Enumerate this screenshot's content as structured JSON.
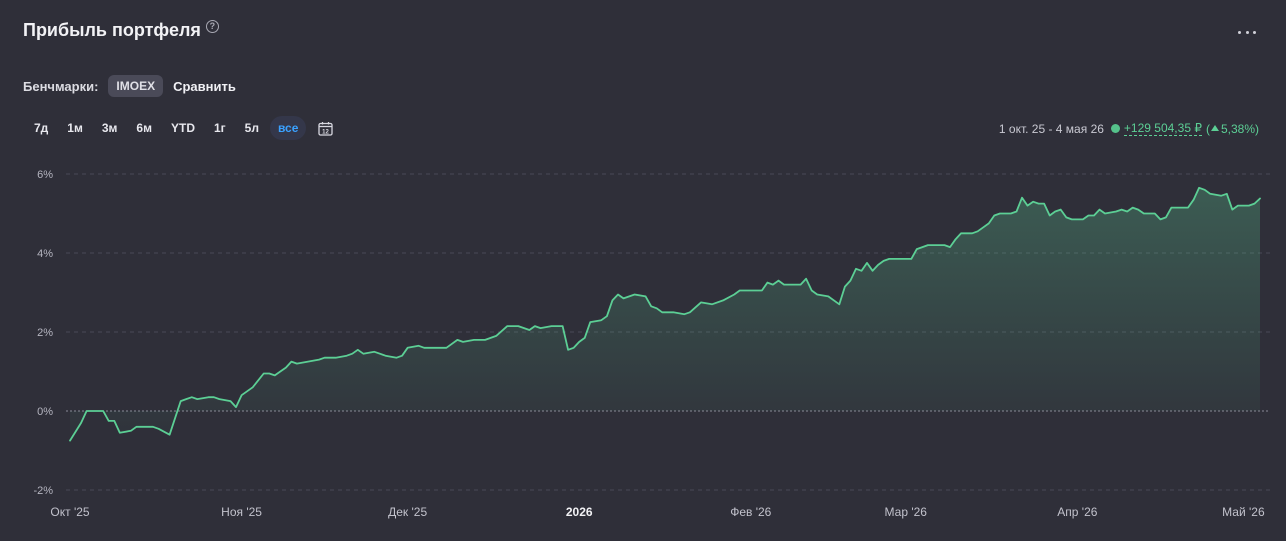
{
  "header": {
    "title": "Прибыль портфеля",
    "help_icon": "?"
  },
  "benchmarks": {
    "label": "Бенчмарки:",
    "chip": "IMOEX",
    "compare": "Сравнить"
  },
  "periods": [
    {
      "label": "7д",
      "active": false
    },
    {
      "label": "1м",
      "active": false
    },
    {
      "label": "3м",
      "active": false
    },
    {
      "label": "6м",
      "active": false
    },
    {
      "label": "YTD",
      "active": false
    },
    {
      "label": "1г",
      "active": false
    },
    {
      "label": "5л",
      "active": false
    },
    {
      "label": "все",
      "active": true
    }
  ],
  "calendar": {
    "day": "12",
    "icon": "calendar-icon"
  },
  "summary": {
    "range": "1 окт. 25 - 4 мая 26",
    "gain": "+129 504,35 ₽",
    "open": "(",
    "pct": "5,38%)"
  },
  "colors": {
    "bg": "#2f2f39",
    "line": "#5ccf95",
    "grid": "#4a4a58",
    "zero": "#8a8a96",
    "active": "#3aa1ff"
  },
  "chart_data": {
    "type": "area",
    "ylim": [
      -2,
      6.5
    ],
    "yticks": [
      -2,
      0,
      2,
      4,
      6
    ],
    "ytick_labels": [
      "-2%",
      "0%",
      "2%",
      "4%",
      "6%"
    ],
    "x_start": "2025-10-01",
    "x_end": "2026-05-04",
    "xticks": [
      {
        "date": "2025-10-01",
        "label": "Окт '25",
        "bold": false
      },
      {
        "date": "2025-11-01",
        "label": "Ноя '25",
        "bold": false
      },
      {
        "date": "2025-12-01",
        "label": "Дек '25",
        "bold": false
      },
      {
        "date": "2026-01-01",
        "label": "2026",
        "bold": true
      },
      {
        "date": "2026-02-01",
        "label": "Фев '26",
        "bold": false
      },
      {
        "date": "2026-03-01",
        "label": "Мар '26",
        "bold": false
      },
      {
        "date": "2026-04-01",
        "label": "Апр '26",
        "bold": false
      },
      {
        "date": "2026-05-01",
        "label": "Май '26",
        "bold": false
      }
    ],
    "series": [
      {
        "values": [
          [
            "2025-10-01",
            -0.75
          ],
          [
            "2025-10-03",
            -0.3
          ],
          [
            "2025-10-04",
            0.0
          ],
          [
            "2025-10-07",
            0.0
          ],
          [
            "2025-10-08",
            -0.25
          ],
          [
            "2025-10-09",
            -0.25
          ],
          [
            "2025-10-10",
            -0.55
          ],
          [
            "2025-10-12",
            -0.5
          ],
          [
            "2025-10-13",
            -0.4
          ],
          [
            "2025-10-16",
            -0.4
          ],
          [
            "2025-10-17",
            -0.45
          ],
          [
            "2025-10-19",
            -0.6
          ],
          [
            "2025-10-21",
            0.25
          ],
          [
            "2025-10-22",
            0.3
          ],
          [
            "2025-10-23",
            0.35
          ],
          [
            "2025-10-24",
            0.3
          ],
          [
            "2025-10-26",
            0.35
          ],
          [
            "2025-10-27",
            0.35
          ],
          [
            "2025-10-28",
            0.3
          ],
          [
            "2025-10-30",
            0.25
          ],
          [
            "2025-10-31",
            0.1
          ],
          [
            "2025-11-01",
            0.4
          ],
          [
            "2025-11-03",
            0.6
          ],
          [
            "2025-11-05",
            0.95
          ],
          [
            "2025-11-06",
            0.95
          ],
          [
            "2025-11-07",
            0.9
          ],
          [
            "2025-11-08",
            1.0
          ],
          [
            "2025-11-09",
            1.1
          ],
          [
            "2025-11-10",
            1.25
          ],
          [
            "2025-11-11",
            1.2
          ],
          [
            "2025-11-13",
            1.25
          ],
          [
            "2025-11-15",
            1.3
          ],
          [
            "2025-11-16",
            1.35
          ],
          [
            "2025-11-18",
            1.35
          ],
          [
            "2025-11-20",
            1.4
          ],
          [
            "2025-11-21",
            1.45
          ],
          [
            "2025-11-22",
            1.55
          ],
          [
            "2025-11-23",
            1.45
          ],
          [
            "2025-11-25",
            1.5
          ],
          [
            "2025-11-27",
            1.4
          ],
          [
            "2025-11-29",
            1.35
          ],
          [
            "2025-11-30",
            1.4
          ],
          [
            "2025-12-01",
            1.6
          ],
          [
            "2025-12-03",
            1.65
          ],
          [
            "2025-12-04",
            1.6
          ],
          [
            "2025-12-06",
            1.6
          ],
          [
            "2025-12-08",
            1.6
          ],
          [
            "2025-12-10",
            1.8
          ],
          [
            "2025-12-11",
            1.75
          ],
          [
            "2025-12-13",
            1.8
          ],
          [
            "2025-12-15",
            1.8
          ],
          [
            "2025-12-17",
            1.9
          ],
          [
            "2025-12-19",
            2.15
          ],
          [
            "2025-12-21",
            2.15
          ],
          [
            "2025-12-23",
            2.05
          ],
          [
            "2025-12-24",
            2.15
          ],
          [
            "2025-12-25",
            2.1
          ],
          [
            "2025-12-27",
            2.15
          ],
          [
            "2025-12-29",
            2.15
          ],
          [
            "2025-12-30",
            1.55
          ],
          [
            "2025-12-31",
            1.6
          ],
          [
            "2026-01-01",
            1.75
          ],
          [
            "2026-01-02",
            1.85
          ],
          [
            "2026-01-03",
            2.25
          ],
          [
            "2026-01-05",
            2.3
          ],
          [
            "2026-01-06",
            2.4
          ],
          [
            "2026-01-07",
            2.8
          ],
          [
            "2026-01-08",
            2.95
          ],
          [
            "2026-01-09",
            2.85
          ],
          [
            "2026-01-11",
            2.95
          ],
          [
            "2026-01-13",
            2.9
          ],
          [
            "2026-01-14",
            2.65
          ],
          [
            "2026-01-15",
            2.6
          ],
          [
            "2026-01-16",
            2.5
          ],
          [
            "2026-01-18",
            2.5
          ],
          [
            "2026-01-20",
            2.45
          ],
          [
            "2026-01-21",
            2.5
          ],
          [
            "2026-01-23",
            2.75
          ],
          [
            "2026-01-25",
            2.7
          ],
          [
            "2026-01-27",
            2.8
          ],
          [
            "2026-01-29",
            2.95
          ],
          [
            "2026-01-30",
            3.05
          ],
          [
            "2026-02-01",
            3.05
          ],
          [
            "2026-02-03",
            3.05
          ],
          [
            "2026-02-04",
            3.25
          ],
          [
            "2026-02-05",
            3.2
          ],
          [
            "2026-02-06",
            3.3
          ],
          [
            "2026-02-07",
            3.2
          ],
          [
            "2026-02-09",
            3.2
          ],
          [
            "2026-02-10",
            3.2
          ],
          [
            "2026-02-11",
            3.35
          ],
          [
            "2026-02-12",
            3.05
          ],
          [
            "2026-02-13",
            2.95
          ],
          [
            "2026-02-15",
            2.9
          ],
          [
            "2026-02-17",
            2.7
          ],
          [
            "2026-02-18",
            3.15
          ],
          [
            "2026-02-19",
            3.3
          ],
          [
            "2026-02-20",
            3.6
          ],
          [
            "2026-02-21",
            3.55
          ],
          [
            "2026-02-22",
            3.75
          ],
          [
            "2026-02-23",
            3.55
          ],
          [
            "2026-02-24",
            3.7
          ],
          [
            "2026-02-25",
            3.8
          ],
          [
            "2026-02-26",
            3.85
          ],
          [
            "2026-03-01",
            3.85
          ],
          [
            "2026-03-02",
            3.85
          ],
          [
            "2026-03-03",
            4.1
          ],
          [
            "2026-03-04",
            4.15
          ],
          [
            "2026-03-05",
            4.2
          ],
          [
            "2026-03-08",
            4.2
          ],
          [
            "2026-03-09",
            4.15
          ],
          [
            "2026-03-10",
            4.35
          ],
          [
            "2026-03-11",
            4.5
          ],
          [
            "2026-03-13",
            4.5
          ],
          [
            "2026-03-14",
            4.55
          ],
          [
            "2026-03-15",
            4.65
          ],
          [
            "2026-03-16",
            4.75
          ],
          [
            "2026-03-17",
            4.95
          ],
          [
            "2026-03-18",
            5.0
          ],
          [
            "2026-03-20",
            5.0
          ],
          [
            "2026-03-21",
            5.05
          ],
          [
            "2026-03-22",
            5.4
          ],
          [
            "2026-03-23",
            5.2
          ],
          [
            "2026-03-24",
            5.3
          ],
          [
            "2026-03-25",
            5.25
          ],
          [
            "2026-03-26",
            5.25
          ],
          [
            "2026-03-27",
            4.95
          ],
          [
            "2026-03-28",
            5.05
          ],
          [
            "2026-03-29",
            5.1
          ],
          [
            "2026-03-30",
            4.9
          ],
          [
            "2026-03-31",
            4.85
          ],
          [
            "2026-04-02",
            4.85
          ],
          [
            "2026-04-03",
            4.95
          ],
          [
            "2026-04-04",
            4.95
          ],
          [
            "2026-04-05",
            5.1
          ],
          [
            "2026-04-06",
            5.0
          ],
          [
            "2026-04-08",
            5.05
          ],
          [
            "2026-04-09",
            5.1
          ],
          [
            "2026-04-10",
            5.05
          ],
          [
            "2026-04-11",
            5.15
          ],
          [
            "2026-04-12",
            5.1
          ],
          [
            "2026-04-13",
            5.0
          ],
          [
            "2026-04-15",
            5.0
          ],
          [
            "2026-04-16",
            4.85
          ],
          [
            "2026-04-17",
            4.9
          ],
          [
            "2026-04-18",
            5.15
          ],
          [
            "2026-04-20",
            5.15
          ],
          [
            "2026-04-21",
            5.15
          ],
          [
            "2026-04-22",
            5.35
          ],
          [
            "2026-04-23",
            5.65
          ],
          [
            "2026-04-24",
            5.6
          ],
          [
            "2026-04-25",
            5.5
          ],
          [
            "2026-04-27",
            5.45
          ],
          [
            "2026-04-28",
            5.5
          ],
          [
            "2026-04-29",
            5.1
          ],
          [
            "2026-04-30",
            5.2
          ],
          [
            "2026-05-02",
            5.2
          ],
          [
            "2026-05-03",
            5.25
          ],
          [
            "2026-05-04",
            5.38
          ]
        ]
      }
    ]
  }
}
